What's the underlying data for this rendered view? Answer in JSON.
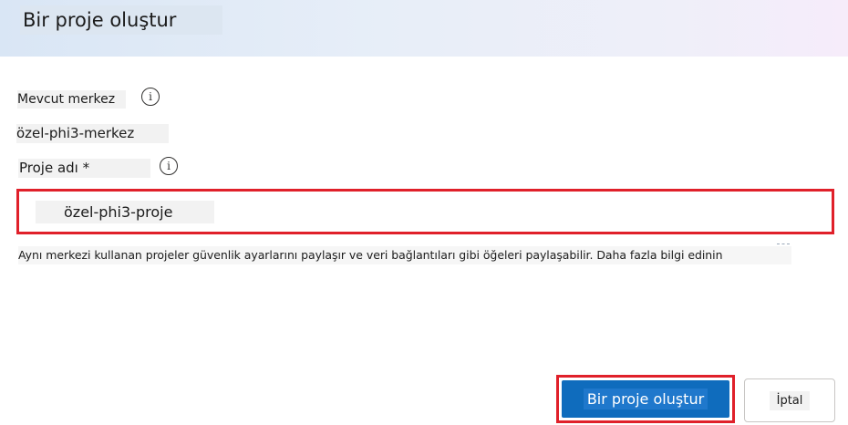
{
  "dialog": {
    "title": "Bir proje oluştur"
  },
  "form": {
    "hub_label": "Mevcut merkez",
    "hub_value": "özel-phi3-merkez",
    "project_name_label": "Proje adı *",
    "project_name_value": "özel-phi3-proje",
    "help_text": "Aynı merkezi kullanan projeler güvenlik ayarlarını paylaşır ve veri bağlantıları gibi öğeleri paylaşabilir. Daha fazla bilgi edinin"
  },
  "actions": {
    "create_label": "Bir proje oluştur",
    "cancel_label": "İptal"
  },
  "colors": {
    "primary": "#0f6cbd",
    "highlight": "#e0202a"
  },
  "icons": {
    "info": "info-icon"
  }
}
